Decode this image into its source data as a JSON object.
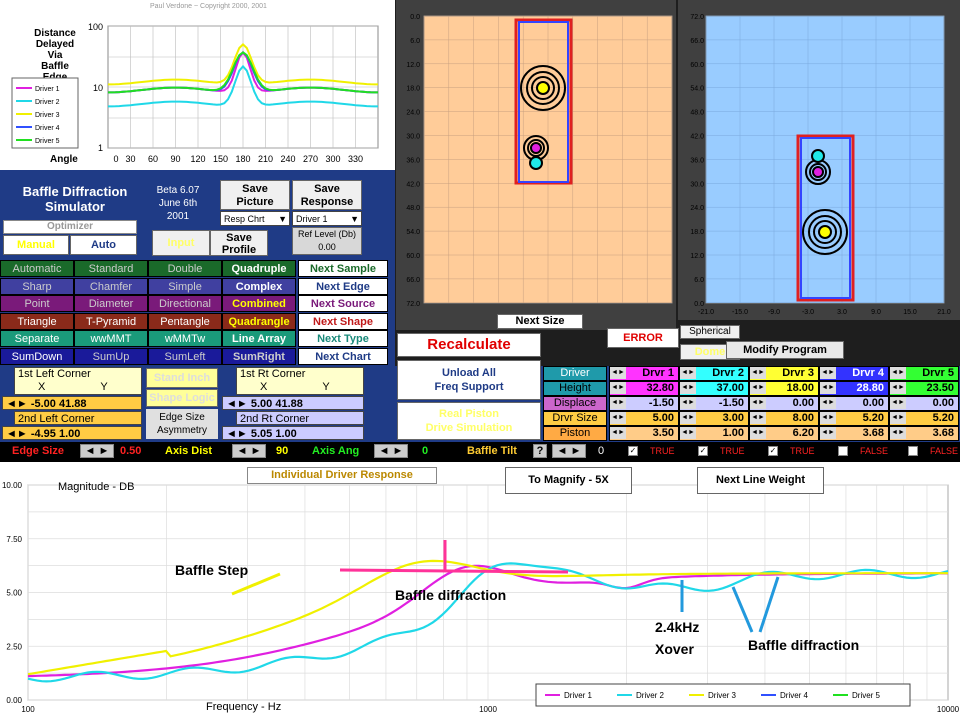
{
  "copyright": "Paul Verdone ~ Copyright 2000, 2001",
  "angle_chart": {
    "title_lines": [
      "Distance",
      "Delayed",
      "Via",
      "Baffle",
      "Edge"
    ],
    "y_ticks": [
      "100",
      "10",
      "1"
    ],
    "x_ticks": [
      "0",
      "30",
      "60",
      "90",
      "120",
      "150",
      "180",
      "210",
      "240",
      "270",
      "300",
      "330"
    ],
    "xlabel": "Angle",
    "legend": [
      "Driver 1",
      "Driver 2",
      "Driver 3",
      "Driver 4",
      "Driver 5"
    ]
  },
  "app": {
    "title_line1": "Baffle Diffraction",
    "title_line2": "Simulator",
    "beta": "Beta 6.07",
    "date1": "June 6th",
    "date2": "2001"
  },
  "buttons": {
    "save_picture_1": "Save",
    "save_picture_2": "Picture",
    "save_response_1": "Save",
    "save_response_2": "Response",
    "resp_chrt": "Resp Chrt",
    "driver_sel": "Driver 1",
    "ref_level": "Ref Level (Db)",
    "ref_value": "0.00",
    "optimizer": "Optimizer",
    "manual": "Manual",
    "auto": "Auto",
    "input": "Input",
    "save_profile_1": "Save",
    "save_profile_2": "Profile",
    "recalculate": "Recalculate",
    "unload_1": "Unload All",
    "unload_2": "Freq Support",
    "real_piston_1": "Real Piston",
    "real_piston_2": "Drive Simulation",
    "next_size": "Next Size",
    "error": "ERROR",
    "spherical": "Spherical",
    "dome": "Dome",
    "modify": "Modify Program",
    "individual": "Individual Driver Response",
    "magnify": "To Magnify - 5X",
    "next_line": "Next Line Weight"
  },
  "grid_rows": [
    [
      "Automatic",
      "Standard",
      "Double",
      "Quadruple",
      "Next Sample"
    ],
    [
      "Sharp",
      "Chamfer",
      "Simple",
      "Complex",
      "Next Edge"
    ],
    [
      "Point",
      "Diameter",
      "Directional",
      "Combined",
      "Next Source"
    ],
    [
      "Triangle",
      "T-Pyramid",
      "Pentangle",
      "Quadrangle",
      "Next Shape"
    ],
    [
      "Separate",
      "wwMMT",
      "wMMTw",
      "Line Array",
      "Next Type"
    ],
    [
      "SumDown",
      "SumUp",
      "SumLeft",
      "SumRight",
      "Next Chart"
    ]
  ],
  "corners": {
    "left1": "1st Left Corner",
    "left2": "2nd Left Corner",
    "rt1": "1st Rt Corner",
    "rt2": "2nd Rt Corner",
    "x": "X",
    "y": "Y",
    "l1x": "-5.00",
    "l1y": "41.88",
    "l2x": "-4.95",
    "l2y": "1.00",
    "r1x": "5.00",
    "r1y": "41.88",
    "r2x": "5.05",
    "r2y": "1.00",
    "stand_inch": "Stand Inch",
    "shape_logic": "Shape Logic",
    "edge_size_asym_1": "Edge Size",
    "edge_size_asym_2": "Asymmetry"
  },
  "driver_table": {
    "row_labels": [
      "Driver",
      "Height",
      "Displace",
      "Drvr Size",
      "Piston"
    ],
    "headers": [
      "Drvr 1",
      "Drvr 2",
      "Drvr 3",
      "Drvr 4",
      "Drvr 5"
    ],
    "header_colors": [
      "#ff33ff",
      "#33ffff",
      "#ffff33",
      "#3333ff",
      "#33ff33"
    ],
    "height": [
      "32.80",
      "37.00",
      "18.00",
      "28.80",
      "23.50"
    ],
    "displace": [
      "-1.50",
      "-1.50",
      "0.00",
      "0.00",
      "0.00"
    ],
    "size": [
      "5.00",
      "3.00",
      "8.00",
      "5.20",
      "5.20"
    ],
    "piston": [
      "3.50",
      "1.00",
      "6.20",
      "3.68",
      "3.68"
    ]
  },
  "controls": {
    "edge_size": "Edge Size",
    "edge_val": "0.50",
    "axis_dist": "Axis Dist",
    "axis_dist_val": "90",
    "axis_ang": "Axis Ang",
    "axis_ang_val": "0",
    "baffle_tilt": "Baffle Tilt",
    "tilt_val": "0",
    "q": "?",
    "flags": [
      "TRUE",
      "TRUE",
      "TRUE",
      "FALSE",
      "FALSE"
    ]
  },
  "baffle_views": {
    "left_y_ticks": [
      "0.0",
      "6.0",
      "12.0",
      "18.0",
      "24.0",
      "30.0",
      "36.0",
      "42.0",
      "48.0",
      "54.0",
      "60.0",
      "66.0",
      "72.0"
    ],
    "right_y_ticks": [
      "72.0",
      "66.0",
      "60.0",
      "54.0",
      "48.0",
      "42.0",
      "36.0",
      "30.0",
      "24.0",
      "18.0",
      "12.0",
      "6.0",
      "0.0"
    ],
    "right_x_ticks": [
      "-21.0",
      "-15.0",
      "-9.0",
      "-3.0",
      "3.0",
      "9.0",
      "15.0",
      "21.0"
    ]
  },
  "freq_chart": {
    "y_ticks": [
      "10.00",
      "7.50",
      "5.00",
      "2.50",
      "0.00"
    ],
    "x_ticks": [
      "100",
      "1000",
      "10000"
    ],
    "ylabel": "Magnitude - DB",
    "xlabel": "Frequency - Hz",
    "legend": [
      "Driver 1",
      "Driver 2",
      "Driver 3",
      "Driver 4",
      "Driver 5"
    ],
    "annotations": {
      "baffle_step": "Baffle Step",
      "baffle_diff1": "Baffle diffraction",
      "xover1": "2.4kHz",
      "xover2": "Xover",
      "baffle_diff2": "Baffle diffraction"
    }
  },
  "colors": {
    "d1": "#e020e0",
    "d2": "#20d8e8",
    "d3": "#f0f000",
    "d4": "#3050ff",
    "d5": "#20e020",
    "accent": "#ff3399",
    "arrow": "#2299dd"
  }
}
